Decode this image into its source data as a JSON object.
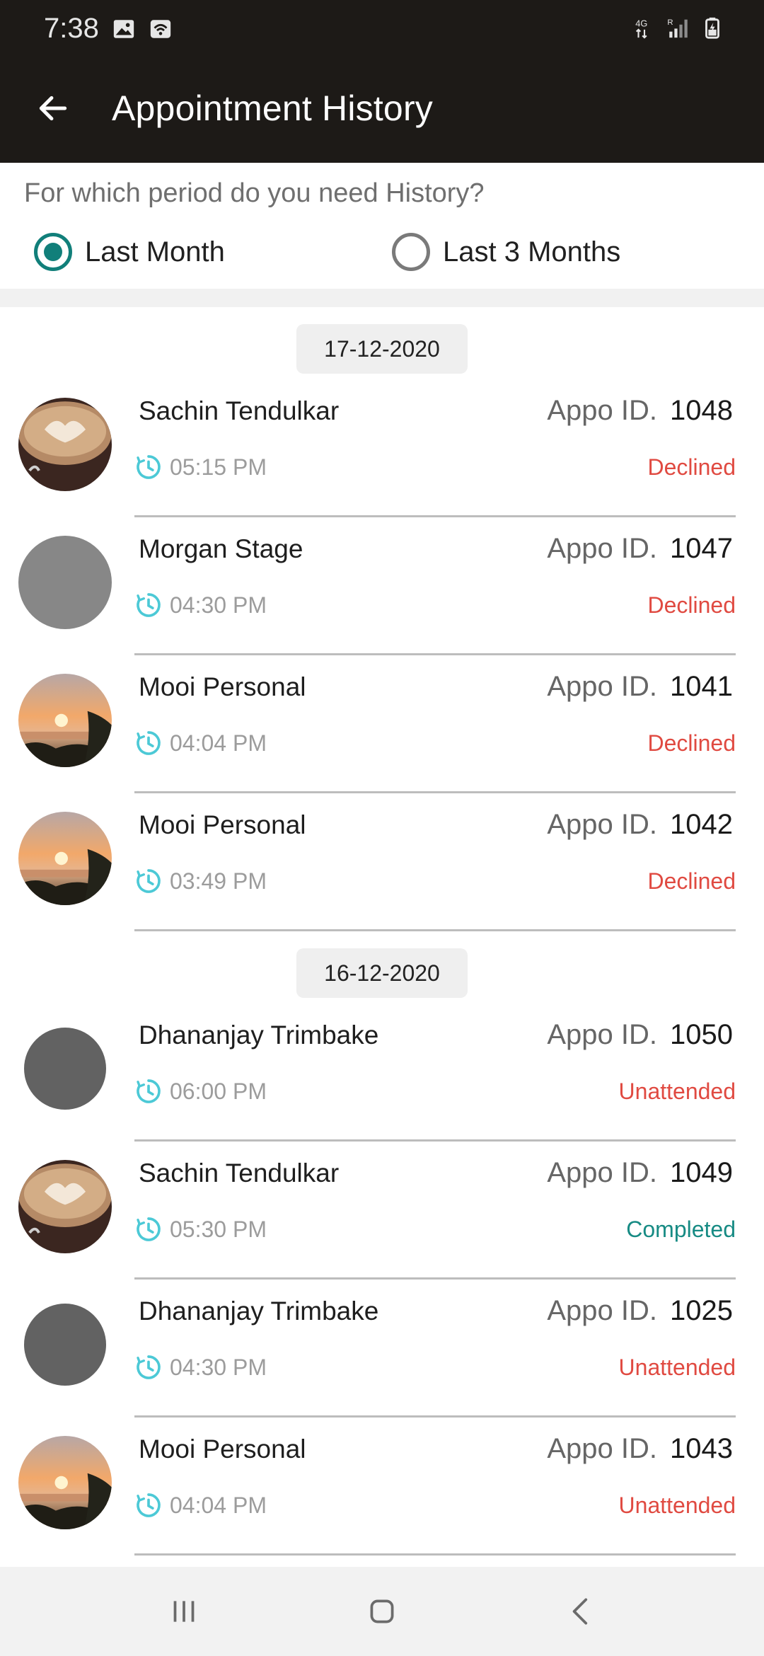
{
  "status_bar": {
    "time": "7:38",
    "icons": [
      "gallery-icon",
      "wifi-call-icon",
      "4g-data-icon",
      "signal-icon",
      "battery-charging-icon"
    ]
  },
  "app_bar": {
    "title": "Appointment History",
    "back_icon": "arrow-left-icon"
  },
  "period": {
    "question": "For which period do you need History?",
    "options": [
      {
        "label": "Last Month",
        "selected": true
      },
      {
        "label": "Last 3 Months",
        "selected": false
      }
    ]
  },
  "groups": [
    {
      "date": "17-12-2020",
      "items": [
        {
          "name": "Sachin Tendulkar",
          "id_label": "Appo ID.",
          "id": "1048",
          "time": "05:15 PM",
          "status": "Declined",
          "avatar": "coffee"
        },
        {
          "name": "Morgan Stage",
          "id_label": "Appo ID.",
          "id": "1047",
          "time": "04:30 PM",
          "status": "Declined",
          "avatar": "grey"
        },
        {
          "name": "Mooi Personal",
          "id_label": "Appo ID.",
          "id": "1041",
          "time": "04:04 PM",
          "status": "Declined",
          "avatar": "sunset"
        },
        {
          "name": "Mooi Personal",
          "id_label": "Appo ID.",
          "id": "1042",
          "time": "03:49 PM",
          "status": "Declined",
          "avatar": "sunset"
        }
      ]
    },
    {
      "date": "16-12-2020",
      "items": [
        {
          "name": "Dhananjay Trimbake",
          "id_label": "Appo ID.",
          "id": "1050",
          "time": "06:00 PM",
          "status": "Unattended",
          "avatar": "dark"
        },
        {
          "name": "Sachin Tendulkar",
          "id_label": "Appo ID.",
          "id": "1049",
          "time": "05:30 PM",
          "status": "Completed",
          "avatar": "coffee"
        },
        {
          "name": "Dhananjay Trimbake",
          "id_label": "Appo ID.",
          "id": "1025",
          "time": "04:30 PM",
          "status": "Unattended",
          "avatar": "dark"
        },
        {
          "name": "Mooi Personal",
          "id_label": "Appo ID.",
          "id": "1043",
          "time": "04:04 PM",
          "status": "Unattended",
          "avatar": "sunset"
        }
      ]
    }
  ],
  "colors": {
    "app_bar": "#1d1a17",
    "accent": "#117f7a",
    "declined": "#e04a41",
    "unattended": "#e04a41",
    "completed": "#178b84",
    "clock": "#4cc9d6"
  },
  "nav_bar": {
    "icons": [
      "recent-apps-icon",
      "home-icon",
      "back-icon"
    ]
  }
}
